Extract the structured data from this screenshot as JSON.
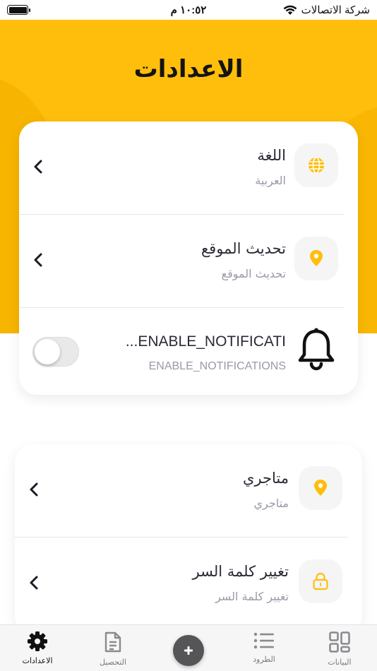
{
  "status_bar": {
    "carrier": "شركة الاتصالات",
    "time": "١٠:٥٢ م"
  },
  "page": {
    "title": "الاعدادات"
  },
  "settings_main": [
    {
      "title": "اللغة",
      "subtitle": "العربية",
      "icon": "globe-icon"
    },
    {
      "title": "تحديث الموقع",
      "subtitle": "تحديث الموقع",
      "icon": "location-pin-icon"
    }
  ],
  "notifications": {
    "title": "ENABLE_NOTIFICATIONS",
    "title_display": "...ENABLE_NOTIFICATI",
    "subtitle": "ENABLE_NOTIFICATIONS",
    "toggle_on": false,
    "icon": "bell-icon"
  },
  "settings_secondary": [
    {
      "title": "متاجري",
      "subtitle": "متاجري",
      "icon": "location-pin-icon"
    },
    {
      "title": "تغيير كلمة السر",
      "subtitle": "تغيير كلمة السر",
      "icon": "lock-icon"
    }
  ],
  "tabbar": {
    "items": [
      {
        "label": "الاعدادات",
        "icon": "gear-icon",
        "active": true
      },
      {
        "label": "التحصيل",
        "icon": "document-icon",
        "active": false
      },
      {
        "label": "",
        "icon": "plus-icon",
        "active": false
      },
      {
        "label": "الطرود",
        "icon": "list-icon",
        "active": false
      },
      {
        "label": "البيانات",
        "icon": "grid-icon",
        "active": false
      }
    ]
  },
  "colors": {
    "accent": "#ffbe0b",
    "icon_accent": "#ffbe0b",
    "background": "#ffffff",
    "subtitle": "#9a9aa8"
  }
}
